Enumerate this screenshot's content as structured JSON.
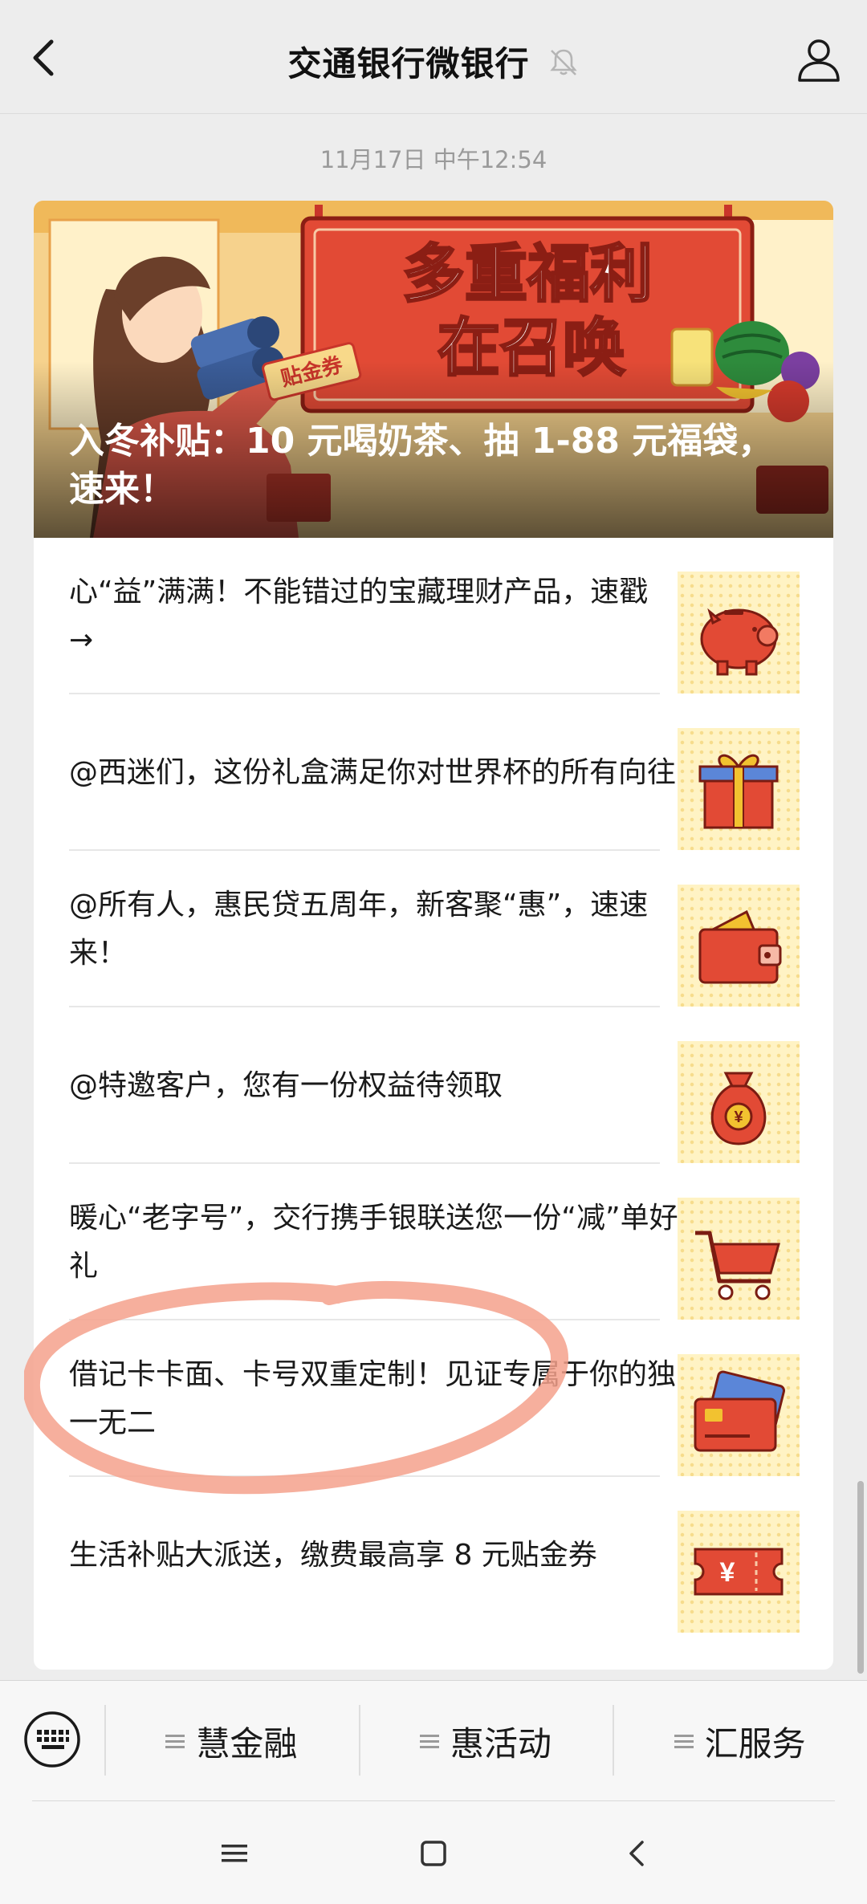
{
  "header": {
    "title": "交通银行微银行",
    "back_icon": "chevron-left-icon",
    "mute_icon": "bell-muted-icon",
    "profile_icon": "person-icon"
  },
  "timestamp": "11月17日 中午12:54",
  "banner": {
    "headline": "入冬补贴：10 元喝奶茶、抽 1-88 元福袋，速来！",
    "sign_line1": "多重福利",
    "sign_line2": "在召唤",
    "tag": "贴金券"
  },
  "articles": [
    {
      "title": "心“益”满满！不能错过的宝藏理财产品，速戳 →",
      "icon": "piggy-bank-icon"
    },
    {
      "title": "@西迷们，这份礼盒满足你对世界杯的所有向往",
      "icon": "gift-box-icon"
    },
    {
      "title": "@所有人，惠民贷五周年，新客聚“惠”，速速来！",
      "icon": "wallet-icon"
    },
    {
      "title": "@特邀客户，您有一份权益待领取",
      "icon": "money-bag-icon"
    },
    {
      "title": "暖心“老字号”，交行携手银联送您一份“减”单好礼",
      "icon": "shopping-cart-icon"
    },
    {
      "title": "借记卡卡面、卡号双重定制！见证专属于你的独一无二",
      "icon": "bank-card-icon"
    },
    {
      "title": "生活补贴大派送，缴费最高享 8 元贴金券",
      "icon": "coupon-ticket-icon"
    }
  ],
  "bottom_menu": {
    "keyboard_icon": "keyboard-icon",
    "tabs": [
      "慧金融",
      "惠活动",
      "汇服务"
    ]
  },
  "system_nav": [
    "menu-icon",
    "home-square-icon",
    "back-chevron-icon"
  ],
  "colors": {
    "accent_red": "#e24a35",
    "annotation_stroke": "#f4a18c",
    "thumb_bg": "#fff3c4"
  }
}
